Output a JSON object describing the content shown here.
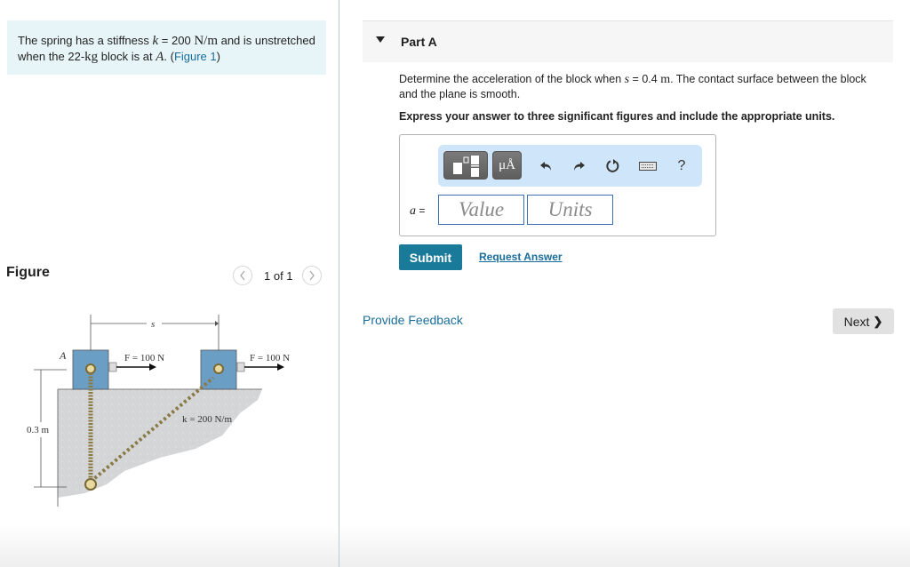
{
  "problem": {
    "intro_prefix": "The spring has a stiffness ",
    "k_symbol": "k",
    "k_value": " = 200 ",
    "k_units": "N/m",
    "intro_mid": " and is unstretched when the 22-",
    "mass_units": "kg",
    "intro_mid2": " block is at ",
    "point": "A",
    "intro_end": ". (",
    "figure_link": "Figure 1",
    "close_paren": ")"
  },
  "figure": {
    "title": "Figure",
    "pager": "1 of 1",
    "prev_icon": "chevron-left-icon",
    "next_icon": "chevron-right-icon",
    "labels": {
      "s": "s",
      "a": "A",
      "force_left": "F = 100 N",
      "force_right": "F = 100 N",
      "stiffness": "k = 200 N/m",
      "height": "0.3 m"
    },
    "colors": {
      "block": "#6b9ec4",
      "ground": "#d4d5d7",
      "spring": "#8a7a45"
    }
  },
  "part": {
    "title": "Part A",
    "question_prefix": "Determine the acceleration of the block when ",
    "s_symbol": "s",
    "question_value": " = 0.4 ",
    "question_units": "m",
    "question_suffix": ". The contact surface between the block and the plane is smooth.",
    "instruction": "Express your answer to three significant figures and include the appropriate units.",
    "toolbar": {
      "templates_icon": "templates-icon",
      "units_label": "μÅ",
      "undo_icon": "undo-icon",
      "redo_icon": "redo-icon",
      "reset_icon": "reset-icon",
      "keyboard_icon": "keyboard-icon",
      "help_label": "?"
    },
    "variable": "a",
    "equals": " =",
    "value_placeholder": "Value",
    "units_placeholder": "Units",
    "submit_label": "Submit",
    "request_answer_label": "Request Answer"
  },
  "footer": {
    "feedback_label": "Provide Feedback",
    "next_label": "Next",
    "next_chevron": "❯"
  },
  "colors": {
    "accent": "#1a7a9a",
    "link": "#1a6d9b",
    "intro_bg": "#e8f5f8",
    "toolbar_bg": "#cfe5fa",
    "input_border": "#3b6fb6"
  }
}
